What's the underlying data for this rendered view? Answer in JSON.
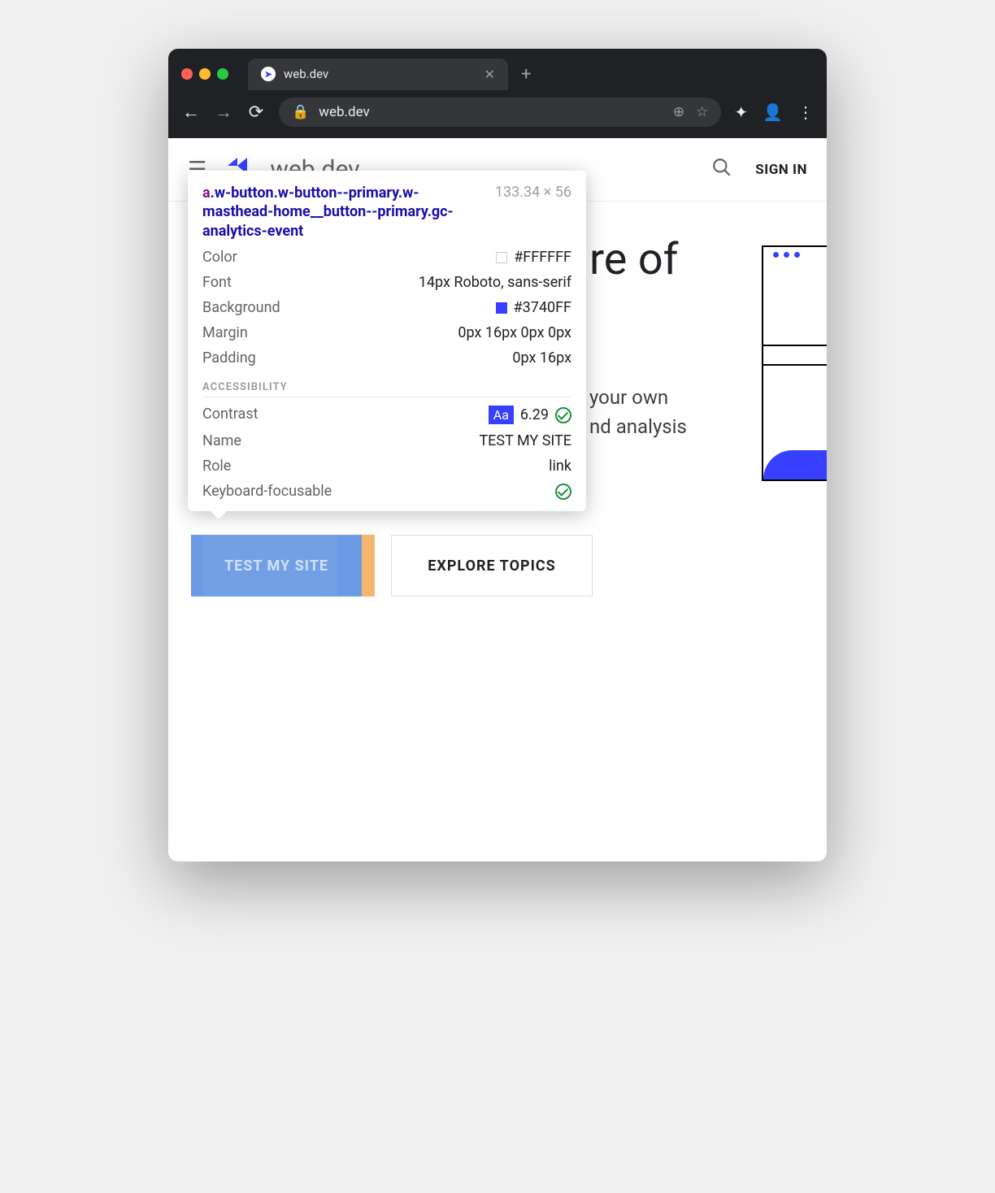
{
  "browser": {
    "tab_title": "web.dev",
    "url": "web.dev"
  },
  "header": {
    "site_name": "web.dev",
    "signin": "SIGN IN"
  },
  "hero": {
    "title_fragment": "re of",
    "text_line1": "your own",
    "text_line2": "nd analysis"
  },
  "buttons": {
    "primary": "TEST MY SITE",
    "secondary": "EXPLORE TOPICS"
  },
  "tooltip": {
    "tag": "a",
    "selector": ".w-button.w-button--primary.w-masthead-home__button--primary.gc-analytics-event",
    "dimensions": "133.34 × 56",
    "props": {
      "color_label": "Color",
      "color_value": "#FFFFFF",
      "font_label": "Font",
      "font_value": "14px Roboto, sans-serif",
      "background_label": "Background",
      "background_value": "#3740FF",
      "margin_label": "Margin",
      "margin_value": "0px 16px 0px 0px",
      "padding_label": "Padding",
      "padding_value": "0px 16px"
    },
    "a11y_heading": "ACCESSIBILITY",
    "a11y": {
      "contrast_label": "Contrast",
      "contrast_badge": "Aa",
      "contrast_value": "6.29",
      "name_label": "Name",
      "name_value": "TEST MY SITE",
      "role_label": "Role",
      "role_value": "link",
      "keyboard_label": "Keyboard-focusable"
    }
  }
}
